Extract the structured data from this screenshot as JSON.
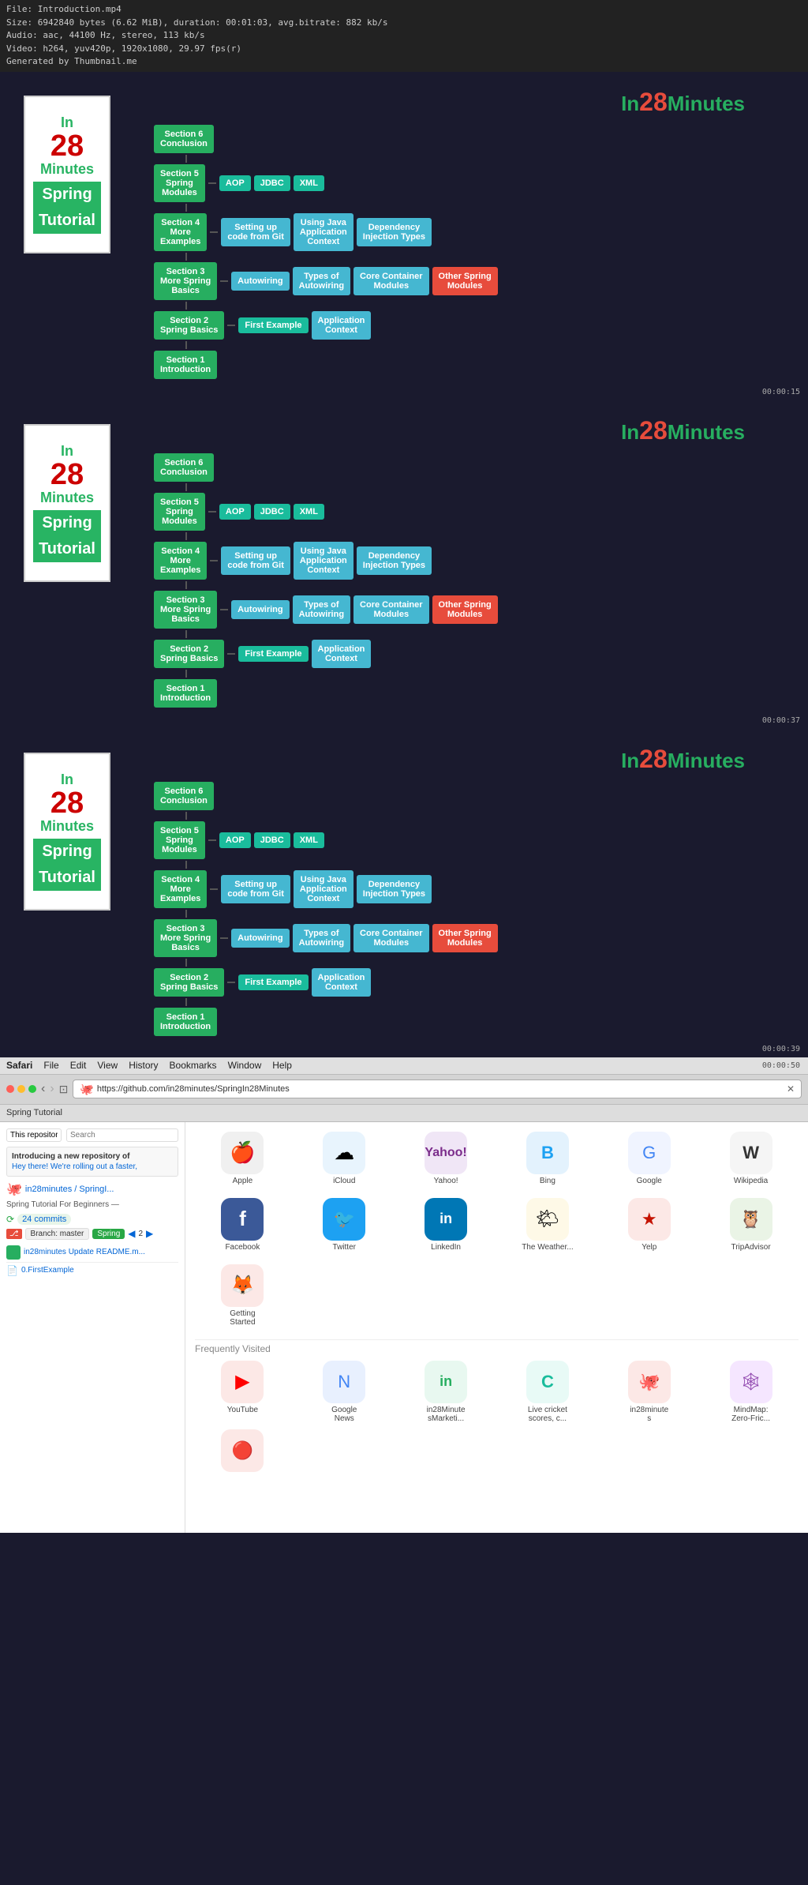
{
  "file_info": {
    "line1": "File: Introduction.mp4",
    "line2": "Size: 6942840 bytes (6.62 MiB), duration: 00:01:03, avg.bitrate: 882 kb/s",
    "line3": "Audio: aac, 44100 Hz, stereo, 113 kb/s",
    "line4": "Video: h264, yuv420p, 1920x1080, 29.97 fps(r)",
    "line5": "Generated by Thumbnail.me"
  },
  "brand": {
    "in": "In",
    "num": "28",
    "minutes": "Minutes"
  },
  "tutorial_logo": {
    "in": "In",
    "num": "28",
    "minutes": "Minutes",
    "spring": "Spring",
    "tutorial": "Tutorial"
  },
  "panels": [
    {
      "timestamp": "00:00:15",
      "sections": {
        "s6": "Section 6\nConclusion",
        "s5": "Section 5\nSpring\nModules",
        "s4": "Section 4\nMore\nExamples",
        "s3": "Section 3\nMore Spring\nBasics",
        "s2": "Section 2\nSpring Basics",
        "s1": "Section 1\nIntroduction"
      },
      "tags": {
        "s5_tags": [
          "AOP",
          "JDBC",
          "XML"
        ],
        "s4_sub": [
          "Setting up\ncode from Git",
          "Using Java\nApplication\nContext",
          "Dependency\nInjection Types"
        ],
        "s3_sub": [
          "Autowiring",
          "Types of\nAutowiring",
          "Core Container\nModules",
          "Other Spring\nModules"
        ],
        "s2_sub": [
          "First Example",
          "Application\nContext"
        ]
      }
    },
    {
      "timestamp": "00:00:37",
      "sections": {
        "s6": "Section 6\nConclusion",
        "s5": "Section 5\nSpring\nModules",
        "s4": "Section 4\nMore\nExamples",
        "s3": "Section 3\nMore Spring\nBasics",
        "s2": "Section 2\nSpring Basics",
        "s1": "Section 1\nIntroduction"
      }
    },
    {
      "timestamp": "00:00:39",
      "sections": {
        "s6": "Section 6\nConclusion",
        "s5": "Section 5\nSpring\nModules",
        "s4": "Section 4\nMore\nExamples",
        "s3": "Section 3\nMore Spring\nBasics",
        "s2": "Section 2\nSpring Basics",
        "s1": "Section 1\nIntroduction"
      }
    }
  ],
  "browser": {
    "menu_items": [
      "Safari",
      "File",
      "Edit",
      "View",
      "History",
      "Bookmarks",
      "Window",
      "Help"
    ],
    "url": "https://github.com/in28minutes/SpringIn28Minutes",
    "bookmarks": [
      "Spring Tutorial"
    ],
    "tab_icons": [
      {
        "label": "Apple",
        "color": "#888",
        "bg": "#f5f5f5",
        "icon": "🍎"
      },
      {
        "label": "iCloud",
        "color": "#4a90d9",
        "bg": "#e8f4fd",
        "icon": "☁"
      },
      {
        "label": "Yahoo!",
        "color": "#7b2d8b",
        "bg": "#f0e6f6",
        "icon": "Y!"
      },
      {
        "label": "Bing",
        "color": "#1da1f2",
        "bg": "#e3f2fd",
        "icon": "B"
      },
      {
        "label": "Google",
        "color": "#4285f4",
        "bg": "#f0f4ff",
        "icon": "G"
      },
      {
        "label": "Wikipedia",
        "color": "#333",
        "bg": "#f5f5f5",
        "icon": "W"
      },
      {
        "label": "Facebook",
        "color": "#3b5998",
        "bg": "#e8eef8",
        "icon": "f"
      },
      {
        "label": "Twitter",
        "color": "#1da1f2",
        "bg": "#e3f4fd",
        "icon": "🐦"
      },
      {
        "label": "LinkedIn",
        "color": "#0077b5",
        "bg": "#e3f2fb",
        "icon": "in"
      },
      {
        "label": "The Weather...",
        "color": "#f39c12",
        "bg": "#fef9e7",
        "icon": "🌤"
      },
      {
        "label": "Yelp",
        "color": "#c41200",
        "bg": "#fce8e6",
        "icon": "🌟"
      },
      {
        "label": "TripAdvisor",
        "color": "#589a43",
        "bg": "#eaf4e6",
        "icon": "🦉"
      },
      {
        "label": "Getting\nStarted",
        "color": "#e74c3c",
        "bg": "#fce8e6",
        "icon": "🦊"
      }
    ],
    "frequently_visited": [
      {
        "label": "YouTube",
        "color": "#ff0000",
        "bg": "#fce8e6",
        "icon": "▶"
      },
      {
        "label": "Google\nNews",
        "color": "#4285f4",
        "bg": "#e8f0fe",
        "icon": "N"
      },
      {
        "label": "in28Minute\nsMarketi...",
        "color": "#27ae60",
        "bg": "#e8f8f0",
        "icon": "in"
      },
      {
        "label": "Live cricket\nscores, c...",
        "color": "#1abc9c",
        "bg": "#e8faf6",
        "icon": "C"
      },
      {
        "label": "in28minute\ns",
        "color": "#e74c3c",
        "bg": "#fce8e6",
        "icon": "🐙"
      },
      {
        "label": "MindMap:\nZero-Fric...",
        "color": "#8e44ad",
        "bg": "#f5e6ff",
        "icon": "🕸"
      }
    ],
    "github_content": {
      "repo_name": "in28minutes / SpringI...",
      "intro": "Introducing a new repository of",
      "intro2": "Hey there! We're rolling out a faster,",
      "desc": "Spring Tutorial For Beginners —",
      "commits": "24 commits",
      "branch": "master",
      "branch_label": "Branch: master",
      "spring_label": "Spring",
      "update_label": "in28minutes Update README.m...",
      "first_example": "0.FirstExample"
    }
  }
}
